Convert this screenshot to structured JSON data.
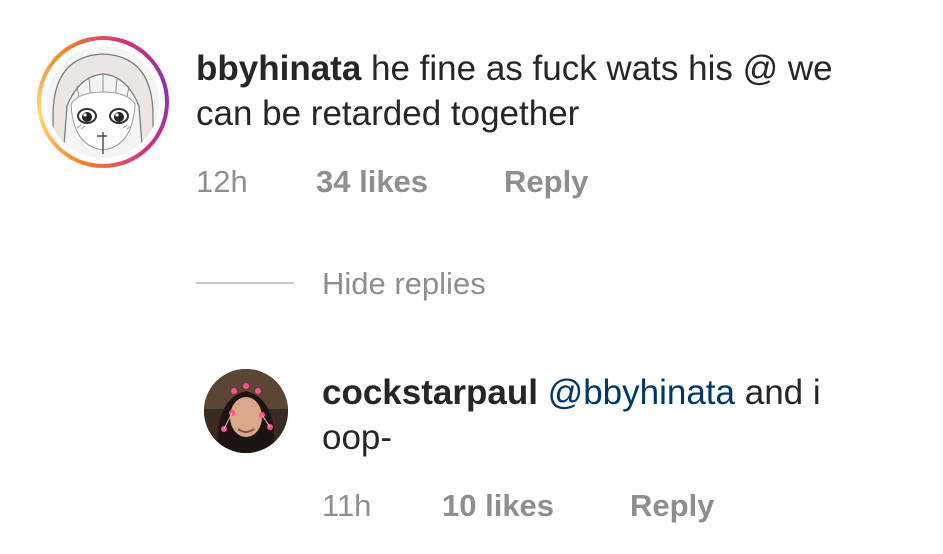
{
  "comment": {
    "username": "bbyhinata",
    "text_line1": " he fine as fuck wats his @ we",
    "text_line2": "can be retarded together",
    "time": "12h",
    "likes": "34 likes",
    "reply_label": "Reply"
  },
  "hide_replies_label": "Hide replies",
  "reply": {
    "username": "cockstarpaul",
    "mention": "@bbyhinata",
    "text_line1": " and i",
    "text_line2": "oop-",
    "time": "11h",
    "likes": "10 likes",
    "reply_label": "Reply"
  },
  "colors": {
    "text": "#262626",
    "meta": "#8e8e8e",
    "mention": "#00376b",
    "ring_start": "#f58529",
    "ring_end": "#dd2a7b"
  }
}
